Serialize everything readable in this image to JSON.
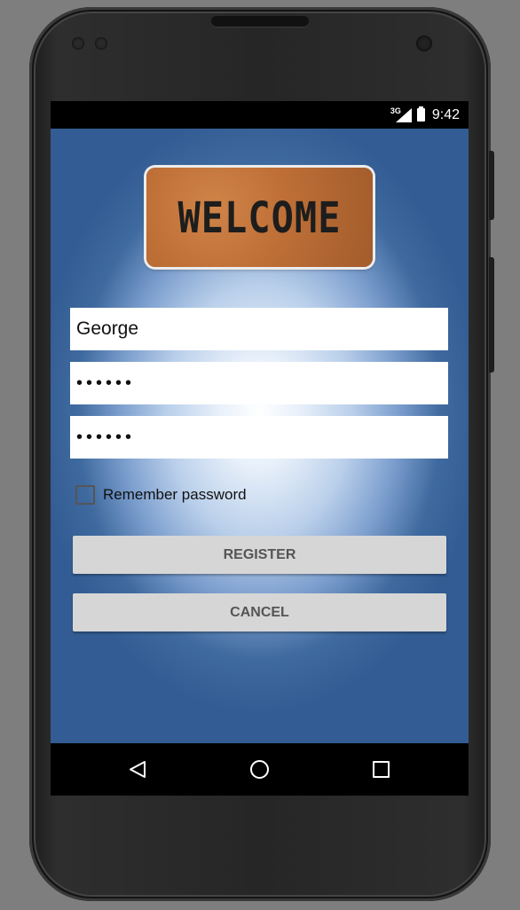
{
  "status_bar": {
    "network_type": "3G",
    "time": "9:42",
    "icons": [
      "signal-icon",
      "battery-charging-icon"
    ]
  },
  "welcome_image": {
    "text": "WELCOME"
  },
  "form": {
    "username_value": "George",
    "password_value": "••••••",
    "confirm_password_value": "••••••",
    "remember_label": "Remember password",
    "remember_checked": false
  },
  "buttons": {
    "register_label": "REGISTER",
    "cancel_label": "CANCEL"
  },
  "nav_bar": {
    "icons": [
      "back-icon",
      "home-icon",
      "recents-icon"
    ]
  },
  "colors": {
    "background_blue": "#325c93",
    "button_gray": "#d6d6d6",
    "mat_brown": "#bf7037"
  }
}
